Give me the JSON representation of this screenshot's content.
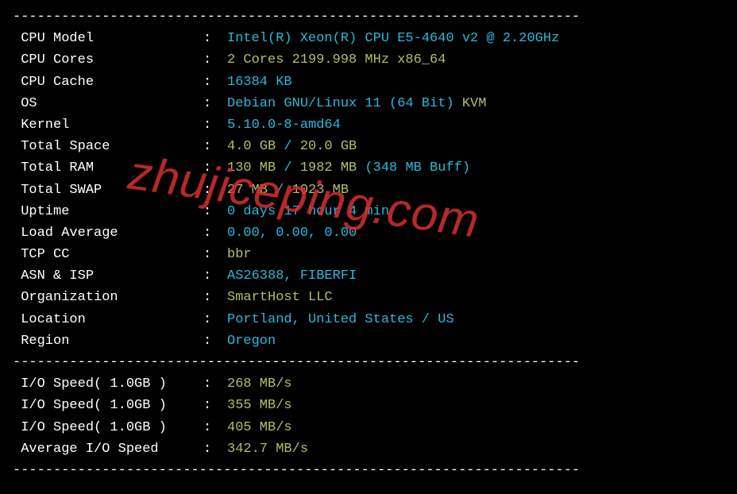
{
  "divider": "----------------------------------------------------------------------",
  "watermark": "zhujiceping.com",
  "info": {
    "cpu_model": {
      "label": " CPU Model",
      "value": "Intel(R) Xeon(R) CPU E5-4640 v2 @ 2.20GHz"
    },
    "cpu_cores": {
      "label": " CPU Cores",
      "value": "2 Cores 2199.998 MHz x86_64"
    },
    "cpu_cache": {
      "label": " CPU Cache",
      "value": "16384 KB"
    },
    "os": {
      "label": " OS",
      "value": "Debian GNU/Linux 11 (64 Bit)",
      "virt": "KVM"
    },
    "kernel": {
      "label": " Kernel",
      "value": "5.10.0-8-amd64"
    },
    "total_space": {
      "label": " Total Space",
      "used": "4.0 GB",
      "total": "20.0 GB"
    },
    "total_ram": {
      "label": " Total RAM",
      "used": "130 MB",
      "total": "1982 MB",
      "buff": "(348 MB Buff)"
    },
    "total_swap": {
      "label": " Total SWAP",
      "used": "27 MB",
      "total": "1023 MB"
    },
    "uptime": {
      "label": " Uptime",
      "value": "0 days 17 hour 4 min"
    },
    "load_avg": {
      "label": " Load Average",
      "value": "0.00, 0.00, 0.00"
    },
    "tcp_cc": {
      "label": " TCP CC",
      "value": "bbr"
    },
    "asn_isp": {
      "label": " ASN & ISP",
      "value": "AS26388, FIBERFI"
    },
    "organization": {
      "label": " Organization",
      "value": "SmartHost LLC"
    },
    "location": {
      "label": " Location",
      "value": "Portland, United States / US"
    },
    "region": {
      "label": " Region",
      "value": "Oregon"
    }
  },
  "io": {
    "test1": {
      "label": " I/O Speed( 1.0GB )",
      "value": "268 MB/s"
    },
    "test2": {
      "label": " I/O Speed( 1.0GB )",
      "value": "355 MB/s"
    },
    "test3": {
      "label": " I/O Speed( 1.0GB )",
      "value": "405 MB/s"
    },
    "avg": {
      "label": " Average I/O Speed",
      "value": "342.7 MB/s"
    }
  }
}
